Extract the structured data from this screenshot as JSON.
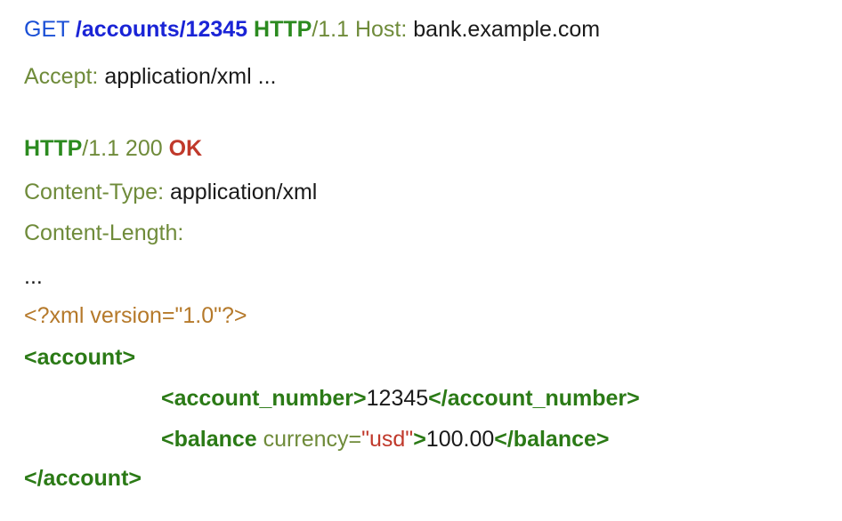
{
  "request": {
    "method": "GET",
    "path": "/accounts/12345",
    "protocol": "HTTP",
    "version": "/1.1",
    "host_header_name": "Host:",
    "host_header_value": " bank.example.com",
    "accept_header_name": "Accept:",
    "accept_header_value": " application/xml ..."
  },
  "response": {
    "protocol": "HTTP",
    "version_status": "/1.1 200",
    "status_text": "OK",
    "content_type_name": "Content-Type:",
    "content_type_value": " application/xml",
    "content_length_name": "Content-Length:",
    "ellipsis": "..."
  },
  "xml": {
    "declaration": "<?xml version=\"1.0\"?>",
    "account_open": "<account>",
    "account_number_open": "<account_number>",
    "account_number_value": "12345",
    "account_number_close": "</account_number>",
    "balance_open_start": "<balance",
    "balance_attr_name": " currency=",
    "balance_attr_value": "\"usd\"",
    "balance_open_end": ">",
    "balance_value": "100.00",
    "balance_close": "</balance>",
    "account_close": "</account>"
  }
}
